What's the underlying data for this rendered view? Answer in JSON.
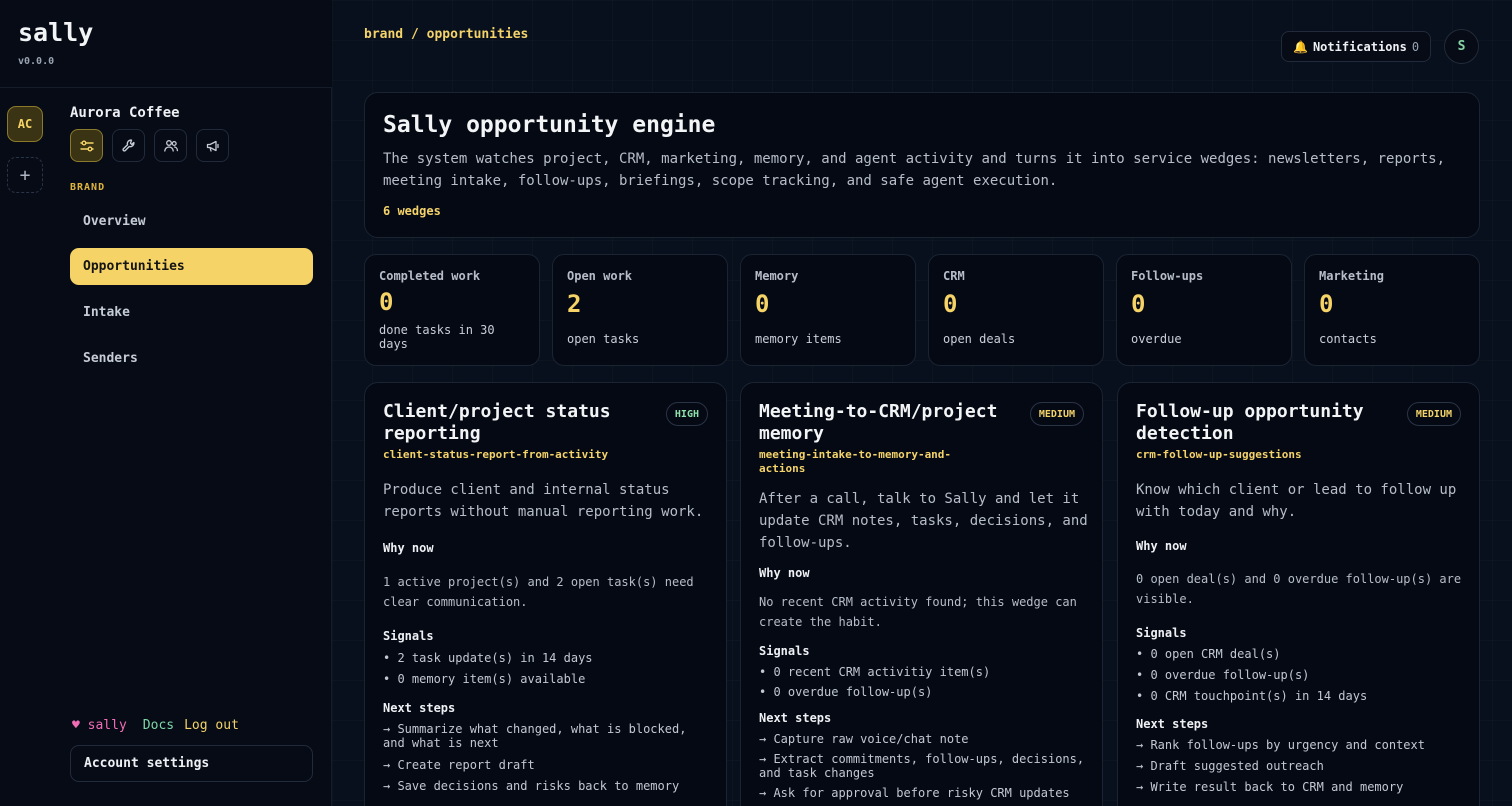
{
  "app": {
    "name": "sally",
    "version": "v0.0.0"
  },
  "workspace": {
    "initials": "AC",
    "add_label": "+",
    "name": "Aurora Coffee"
  },
  "sidebar": {
    "section": "BRAND",
    "items": [
      {
        "label": "Overview"
      },
      {
        "label": "Opportunities",
        "active": true
      },
      {
        "label": "Intake"
      },
      {
        "label": "Senders"
      }
    ],
    "footer": {
      "heart": "♥",
      "sally": "sally",
      "docs": "Docs",
      "logout": "Log out"
    },
    "account": "Account settings"
  },
  "header": {
    "breadcrumb": "brand / opportunities",
    "notif_icon": "🔔",
    "notifications_label": "Notifications",
    "notifications_count": "0",
    "avatar": "S"
  },
  "hero": {
    "title": "Sally opportunity engine",
    "description": "The system watches project, CRM, marketing, memory, and agent activity and turns it into service wedges: newsletters, reports, meeting intake, follow-ups, briefings, scope tracking, and safe agent execution.",
    "count": "6 wedges"
  },
  "stats": [
    {
      "label": "Completed work",
      "value": "0",
      "sub": "done tasks in 30 days"
    },
    {
      "label": "Open work",
      "value": "2",
      "sub": "open tasks"
    },
    {
      "label": "Memory",
      "value": "0",
      "sub": "memory items"
    },
    {
      "label": "CRM",
      "value": "0",
      "sub": "open deals"
    },
    {
      "label": "Follow-ups",
      "value": "0",
      "sub": "overdue"
    },
    {
      "label": "Marketing",
      "value": "0",
      "sub": "contacts"
    }
  ],
  "cards": [
    {
      "title": "Client/project status reporting",
      "priority": "HIGH",
      "slug": "client-status-report-from-activity",
      "description": "Produce client and internal status reports without manual reporting work.",
      "why_label": "Why now",
      "why": "1 active project(s) and 2 open task(s) need clear communication.",
      "signals_label": "Signals",
      "signals": [
        "• 2 task update(s) in 14 days",
        "• 0 memory item(s) available"
      ],
      "steps_label": "Next steps",
      "steps": [
        "→ Summarize what changed, what is blocked, and what is next",
        "→ Create report draft",
        "→ Save decisions and risks back to memory"
      ]
    },
    {
      "title": "Meeting-to-CRM/project memory",
      "priority": "MEDIUM",
      "slug": "meeting-intake-to-memory-and-actions",
      "description": "After a call, talk to Sally and let it update CRM notes, tasks, decisions, and follow-ups.",
      "why_label": "Why now",
      "why": "No recent CRM activity found; this wedge can create the habit.",
      "signals_label": "Signals",
      "signals": [
        "• 0 recent CRM activitiy item(s)",
        "• 0 overdue follow-up(s)"
      ],
      "steps_label": "Next steps",
      "steps": [
        "→ Capture raw voice/chat note",
        "→ Extract commitments, follow-ups, decisions, and task changes",
        "→ Ask for approval before risky CRM updates"
      ]
    },
    {
      "title": "Follow-up opportunity detection",
      "priority": "MEDIUM",
      "slug": "crm-follow-up-suggestions",
      "description": "Know which client or lead to follow up with today and why.",
      "why_label": "Why now",
      "why": "0 open deal(s) and 0 overdue follow-up(s) are visible.",
      "signals_label": "Signals",
      "signals": [
        "• 0 open CRM deal(s)",
        "• 0 overdue follow-up(s)",
        "• 0 CRM touchpoint(s) in 14 days"
      ],
      "steps_label": "Next steps",
      "steps": [
        "→ Rank follow-ups by urgency and context",
        "→ Draft suggested outreach",
        "→ Write result back to CRM and memory"
      ]
    }
  ]
}
